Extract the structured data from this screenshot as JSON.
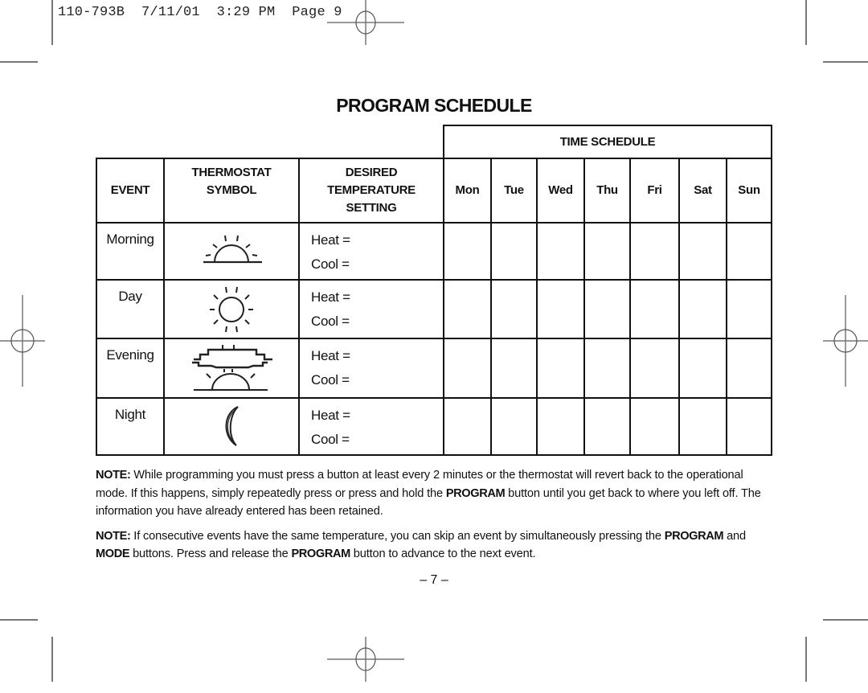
{
  "print_slug": "110-793B  7/11/01  3:29 PM  Page 9",
  "title": "PROGRAM SCHEDULE",
  "table": {
    "group_header": "TIME SCHEDULE",
    "columns": {
      "event": "EVENT",
      "symbol_line1": "THERMOSTAT",
      "symbol_line2": "SYMBOL",
      "temp_line1": "DESIRED",
      "temp_line2": "TEMPERATURE",
      "temp_line3": "SETTING"
    },
    "days": [
      "Mon",
      "Tue",
      "Wed",
      "Thu",
      "Fri",
      "Sat",
      "Sun"
    ],
    "rows": [
      {
        "event": "Morning",
        "symbol": "sunrise-icon",
        "heat": "Heat =",
        "cool": "Cool ="
      },
      {
        "event": "Day",
        "symbol": "sun-icon",
        "heat": "Heat =",
        "cool": "Cool ="
      },
      {
        "event": "Evening",
        "symbol": "sunset-cloud-icon",
        "heat": "Heat =",
        "cool": "Cool ="
      },
      {
        "event": "Night",
        "symbol": "moon-icon",
        "heat": "Heat =",
        "cool": "Cool ="
      }
    ]
  },
  "notes": [
    {
      "label": "NOTE:",
      "parts": [
        {
          "text": " While programming you must press a button at least every 2 minutes or the thermostat will revert back to the operational mode. If this happens, simply repeatedly press or press and hold the ",
          "bold": false
        },
        {
          "text": "PROGRAM",
          "bold": true
        },
        {
          "text": " button until you get back to where you left off. The information you have already entered has been retained.",
          "bold": false
        }
      ]
    },
    {
      "label": "NOTE:",
      "parts": [
        {
          "text": " If consecutive events have the same temperature, you can skip an event by simultaneously pressing the ",
          "bold": false
        },
        {
          "text": "PROGRAM",
          "bold": true
        },
        {
          "text": " and ",
          "bold": false
        },
        {
          "text": "MODE",
          "bold": true
        },
        {
          "text": " buttons. Press and release the ",
          "bold": false
        },
        {
          "text": "PROGRAM",
          "bold": true
        },
        {
          "text": " button to advance to the next event.",
          "bold": false
        }
      ]
    }
  ],
  "page_number": "– 7 –"
}
